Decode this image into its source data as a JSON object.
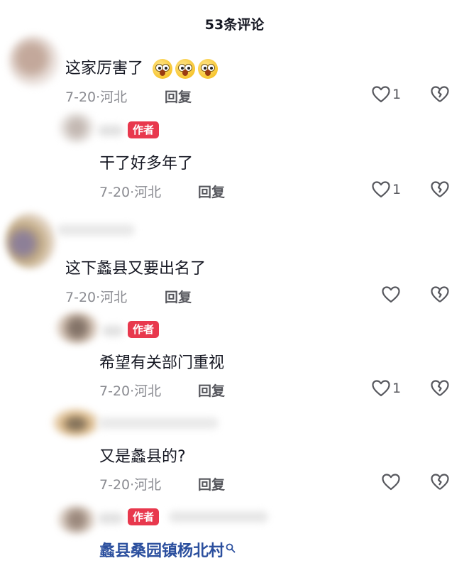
{
  "header": {
    "title": "53条评论"
  },
  "author_badge": "作者",
  "reply_label": "回复",
  "comments": [
    {
      "text": "这家厉害了",
      "emoji": [
        "astonished-emoji",
        "astonished-emoji",
        "astonished-emoji"
      ],
      "meta": "7-20·河北",
      "likes": "1"
    },
    {
      "text": "干了好多年了",
      "meta": "7-20·河北",
      "likes": "1"
    },
    {
      "text": "这下蠡县又要出名了",
      "meta": "7-20·河北",
      "likes": ""
    },
    {
      "text": "希望有关部门重视",
      "meta": "7-20·河北",
      "likes": "1"
    },
    {
      "text": "又是蠡县的?",
      "meta": "7-20·河北",
      "likes": ""
    },
    {
      "text": "蠡县桑园镇杨北村"
    }
  ],
  "colors": {
    "author_badge": "#e8384d",
    "mention_link": "#2b4f9e",
    "meta_gray": "#8a8b91"
  }
}
